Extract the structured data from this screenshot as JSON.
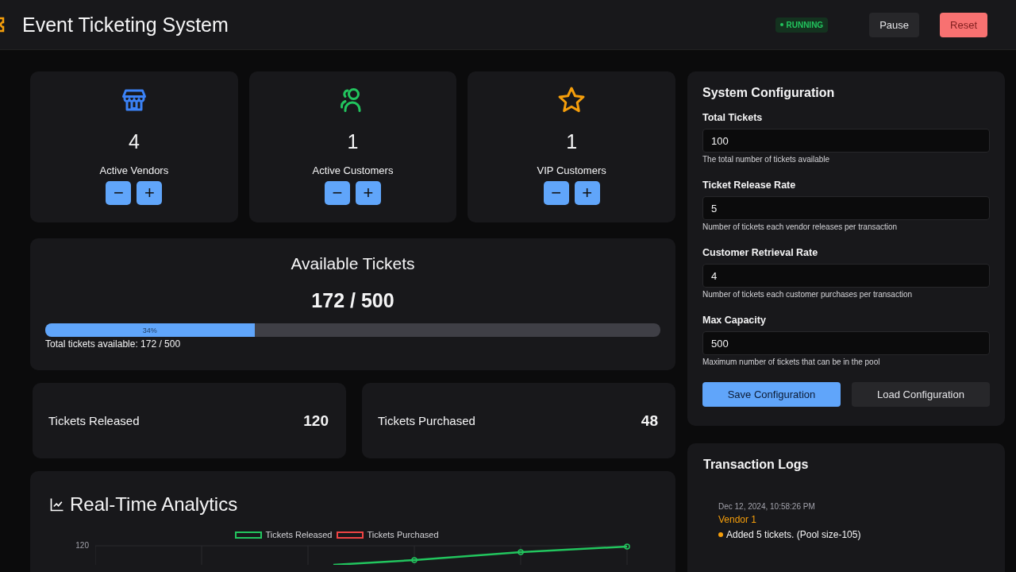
{
  "header": {
    "title": "Event Ticketing System",
    "status": {
      "label": "RUNNING",
      "running": true
    },
    "buttons": [
      {
        "label": "Pause",
        "kind": "secondary"
      },
      {
        "label": "Reset",
        "kind": "danger"
      }
    ]
  },
  "stats": [
    {
      "kind": "vendors",
      "value": "4",
      "label": "Active Vendors",
      "color": "#3b82f6"
    },
    {
      "kind": "customers",
      "value": "1",
      "label": "Active Customers",
      "color": "#22c55e"
    },
    {
      "kind": "vip",
      "value": "1",
      "label": "VIP Customers",
      "color": "#f59e0b"
    }
  ],
  "stepper": {
    "minus": "−",
    "plus": "+"
  },
  "available": {
    "title": "Available Tickets",
    "count": "172 / 500",
    "level": 0.34,
    "percent": "34%",
    "caption": "Total tickets available: 172 / 500"
  },
  "totals": [
    {
      "label": "Tickets Released",
      "value": "120"
    },
    {
      "label": "Tickets Purchased",
      "value": "48"
    }
  ],
  "analytics": {
    "title": "Real-Time Analytics",
    "legend": [
      {
        "label": "Tickets Released",
        "color": "#22c55e"
      },
      {
        "label": "Tickets Purchased",
        "color": "#ef4444"
      }
    ],
    "y_tick": "120"
  },
  "config": {
    "title": "System Configuration",
    "fields": [
      {
        "label": "Total Tickets",
        "value": "100",
        "help": "The total number of tickets available"
      },
      {
        "label": "Ticket Release Rate",
        "value": "5",
        "help": "Number of tickets each vendor releases per transaction"
      },
      {
        "label": "Customer Retrieval Rate",
        "value": "4",
        "help": "Number of tickets each customer purchases per transaction"
      },
      {
        "label": "Max Capacity",
        "value": "500",
        "help": "Maximum number of tickets that can be in the pool"
      }
    ],
    "buttons": [
      {
        "label": "Save Configuration",
        "kind": "primary"
      },
      {
        "label": "Load Configuration",
        "kind": "secondary"
      }
    ]
  },
  "logs": {
    "title": "Transaction Logs",
    "entries": [
      {
        "time": "Dec 12, 2024, 10:58:26 PM",
        "source": "Vendor 1",
        "message": "Added 5 tickets. (Pool size-105)",
        "color": "#f59e0b"
      }
    ]
  }
}
